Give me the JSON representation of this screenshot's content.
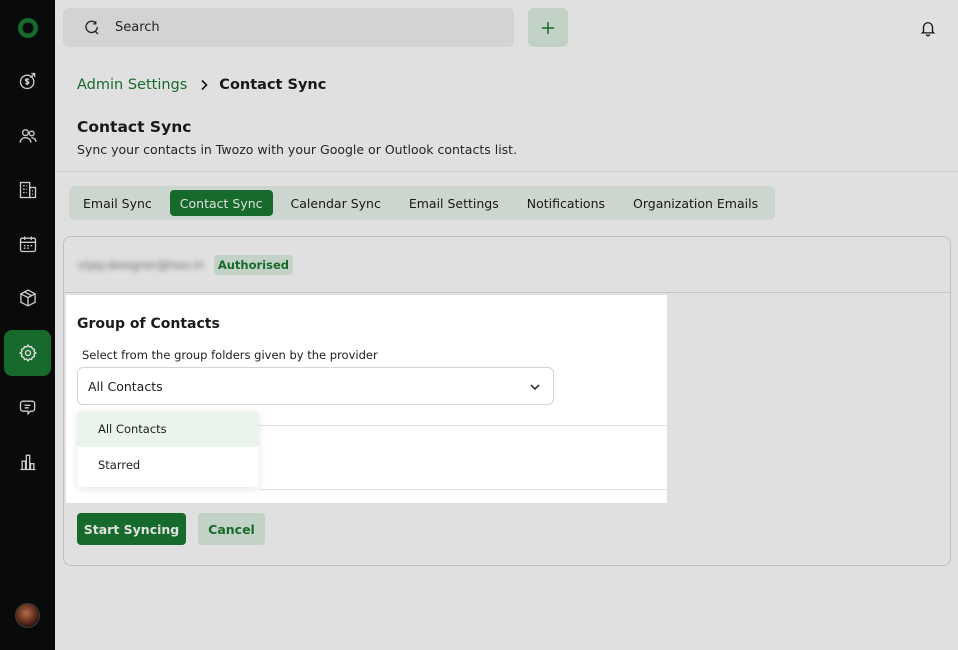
{
  "topbar": {
    "search_label": "Search"
  },
  "breadcrumb": {
    "parent": "Admin Settings",
    "current": "Contact Sync"
  },
  "header": {
    "title": "Contact Sync",
    "subtitle": "Sync your contacts in Twozo with your Google or Outlook contacts list."
  },
  "tabs": [
    {
      "label": "Email Sync",
      "active": false
    },
    {
      "label": "Contact Sync",
      "active": true
    },
    {
      "label": "Calendar Sync",
      "active": false
    },
    {
      "label": "Email Settings",
      "active": false
    },
    {
      "label": "Notifications",
      "active": false
    },
    {
      "label": "Organization Emails",
      "active": false
    }
  ],
  "account": {
    "email": "vijay.designer@hoo.in",
    "status_badge": "Authorised"
  },
  "panel": {
    "title": "Group of Contacts",
    "label": "Select from the group folders given by the provider",
    "selected_value": "All Contacts",
    "options": [
      "All Contacts",
      "Starred"
    ]
  },
  "actions": {
    "start_label": "Start Syncing",
    "cancel_label": "Cancel"
  },
  "colors": {
    "brand_green": "#1a7a33",
    "light_green": "#dff0e3",
    "sidebar_bg": "#0b0d0c"
  },
  "sidebar_icons": [
    "logo-icon",
    "deals-icon",
    "contacts-icon",
    "companies-icon",
    "calendar-icon",
    "products-icon",
    "settings-icon",
    "chat-icon",
    "reports-icon"
  ]
}
